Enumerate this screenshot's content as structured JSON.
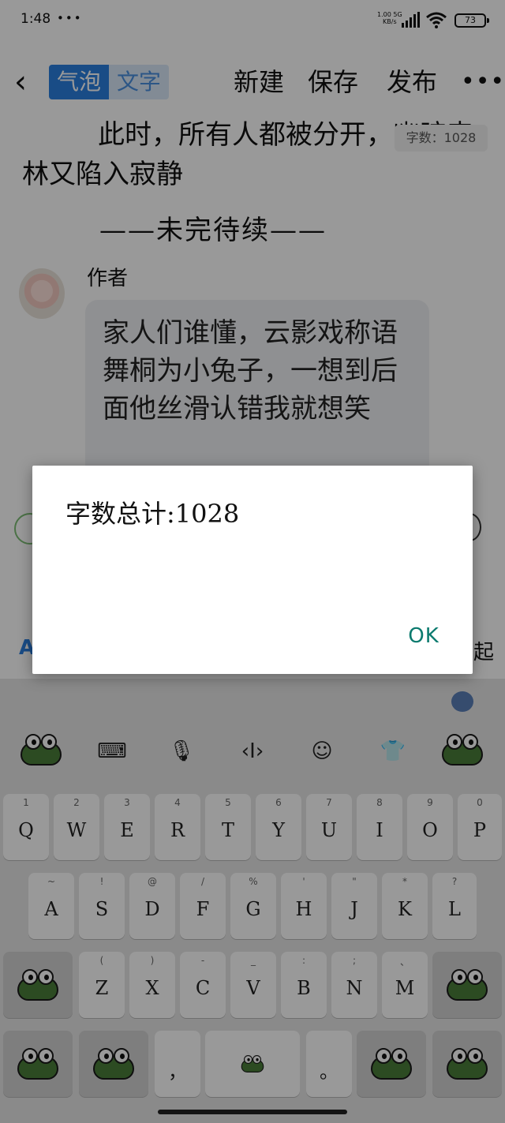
{
  "status_bar": {
    "time": "1:48",
    "extra": "•••",
    "net_speed_top": "1.00 5G",
    "net_speed_bottom": "KB/s",
    "battery": "73"
  },
  "toolbar": {
    "mode_bubble": "气泡",
    "mode_text": "文字",
    "new": "新建",
    "save": "保存",
    "publish": "发布",
    "more": "•••"
  },
  "content": {
    "paragraph1": "此时，所有人都被分开，幽暗森林又陷入寂静",
    "tbc": "——未完待续——",
    "word_badge": "字数：1028",
    "author_label": "作者",
    "author_comment": "家人们谁懂，云影戏称语舞桐为小兔子，一想到后面他丝滑认错我就想笑",
    "partial_collapse": "起"
  },
  "dialog": {
    "message": "字数总计:1028",
    "ok": "OK"
  },
  "keyboard": {
    "row1": [
      {
        "hint": "1",
        "key": "Q"
      },
      {
        "hint": "2",
        "key": "W"
      },
      {
        "hint": "3",
        "key": "E"
      },
      {
        "hint": "4",
        "key": "R"
      },
      {
        "hint": "5",
        "key": "T"
      },
      {
        "hint": "6",
        "key": "Y"
      },
      {
        "hint": "7",
        "key": "U"
      },
      {
        "hint": "8",
        "key": "I"
      },
      {
        "hint": "9",
        "key": "O"
      },
      {
        "hint": "0",
        "key": "P"
      }
    ],
    "row2": [
      {
        "hint": "~",
        "key": "A"
      },
      {
        "hint": "!",
        "key": "S"
      },
      {
        "hint": "@",
        "key": "D"
      },
      {
        "hint": "/",
        "key": "F"
      },
      {
        "hint": "%",
        "key": "G"
      },
      {
        "hint": "'",
        "key": "H"
      },
      {
        "hint": "\"",
        "key": "J"
      },
      {
        "hint": "*",
        "key": "K"
      },
      {
        "hint": "?",
        "key": "L"
      }
    ],
    "row3": [
      {
        "hint": "(",
        "key": "Z"
      },
      {
        "hint": ")",
        "key": "X"
      },
      {
        "hint": "-",
        "key": "C"
      },
      {
        "hint": "_",
        "key": "V"
      },
      {
        "hint": ":",
        "key": "B"
      },
      {
        "hint": ";",
        "key": "N"
      },
      {
        "hint": "、",
        "key": "M"
      }
    ],
    "comma": "，",
    "period": "。"
  }
}
